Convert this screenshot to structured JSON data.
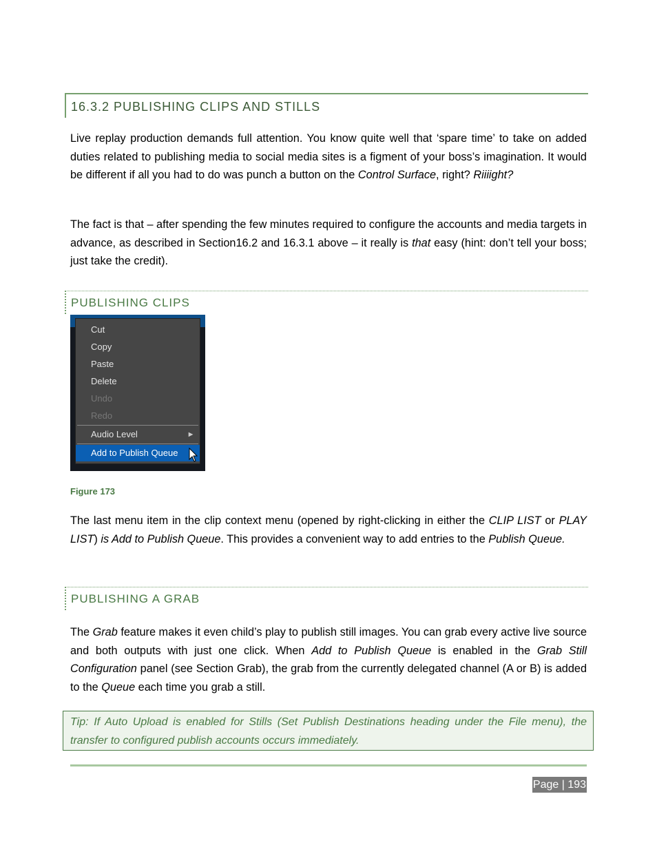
{
  "section_heading": "16.3.2 PUBLISHING CLIPS AND STILLS",
  "intro_paragraph": {
    "parts": [
      "Live replay production demands full attention. You know quite well that ‘spare time’ to take on added duties related to publishing media to social media sites is a figment of your boss’s imagination.  It would be different if all you had to do was punch a button on the ",
      "Control Surface",
      ", right?  ",
      "Riiiight?"
    ]
  },
  "fact_paragraph": {
    "parts": [
      "The fact is that – after spending the few minutes required to configure the accounts and media targets in advance, as described in Section16.2 and 16.3.1 above – it really is ",
      "that",
      " easy (hint: don’t tell your boss; just take the credit)."
    ]
  },
  "clips_heading": "PUBLISHING CLIPS",
  "context_menu": {
    "items": [
      {
        "label": "Cut",
        "enabled": true
      },
      {
        "label": "Copy",
        "enabled": true
      },
      {
        "label": "Paste",
        "enabled": true
      },
      {
        "label": "Delete",
        "enabled": true
      },
      {
        "label": "Undo",
        "enabled": false
      },
      {
        "label": "Redo",
        "enabled": false
      },
      {
        "label": "Audio Level",
        "enabled": true,
        "submenu": true
      },
      {
        "label": "Add to Publish Queue",
        "enabled": true,
        "selected": true
      }
    ],
    "colors": {
      "menu_bg": "#464646",
      "selected_bg": "#0b5fb3",
      "title_bar": "#0d4f8a"
    }
  },
  "figure_caption": "Figure 173",
  "clips_paragraph": {
    "parts": [
      "The last menu item in the clip context menu (opened by right-clicking in either the ",
      "CLIP LIST",
      " or ",
      "PLAY LIST",
      ") ",
      "is Add to Publish Queue",
      ".  This provides a convenient way to add entries to the ",
      "Publish Queue."
    ]
  },
  "grab_heading": "PUBLISHING A GRAB",
  "grab_paragraph": {
    "parts": [
      "The ",
      "Grab",
      " feature makes it even child’s play to publish still images. You can grab every active live source and both outputs with just one click.  When ",
      "Add to Publish Queue",
      " is enabled in the ",
      "Grab Still Configuration",
      " panel (see Section Grab), the grab from the currently delegated channel (A or B) is added to the ",
      "Queue",
      " each time you grab a still."
    ]
  },
  "tip": "Tip: If Auto Upload is enabled for Stills (Set Publish Destinations heading under the File menu), the transfer to configured publish accounts occurs immediately.",
  "footer": {
    "page_label": "Page | 193"
  },
  "colors": {
    "accent_green": "#4a7a45",
    "rule_green": "#a8c8a0"
  }
}
